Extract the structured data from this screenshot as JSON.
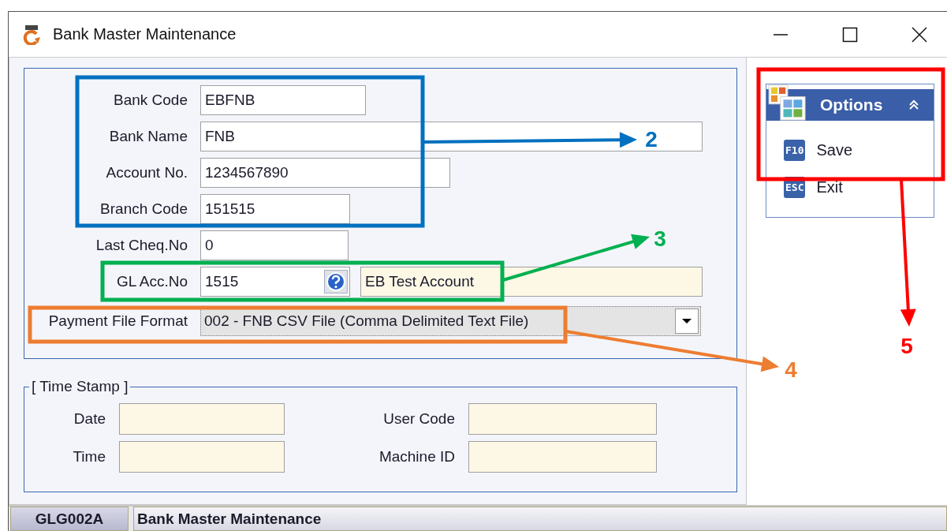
{
  "window": {
    "title": "Bank Master Maintenance"
  },
  "form": {
    "fields": [
      {
        "kind": "text",
        "label": "Bank Code",
        "value": "EBFNB"
      },
      {
        "kind": "text",
        "label": "Bank Name",
        "value": "FNB"
      },
      {
        "kind": "text",
        "label": "Account No.",
        "value": "1234567890"
      },
      {
        "kind": "text",
        "label": "Branch Code",
        "value": "151515"
      },
      {
        "kind": "text",
        "label": "Last Cheq.No",
        "value": "0"
      },
      {
        "kind": "lookup",
        "label": "GL Acc.No",
        "value": "1515",
        "description": "EB Test Account"
      },
      {
        "kind": "combo",
        "label": "Payment File Format",
        "value": "002 - FNB CSV File (Comma Delimited Text File)"
      }
    ]
  },
  "time_stamp": {
    "title": "[ Time Stamp ]",
    "fields": [
      {
        "label": "Date"
      },
      {
        "label": "User Code"
      },
      {
        "label": "Time"
      },
      {
        "label": "Machine ID"
      }
    ]
  },
  "options": {
    "title": "Options",
    "expanded": true,
    "items": [
      {
        "key": "F10",
        "label": "Save"
      },
      {
        "key": "ESC",
        "label": "Exit"
      }
    ]
  },
  "status_bar": {
    "code": "GLG002A",
    "title": "Bank Master Maintenance"
  },
  "annotations": [
    {
      "label": "2",
      "color": "#0070c0"
    },
    {
      "label": "3",
      "color": "#00b050"
    },
    {
      "label": "4",
      "color": "#ed7d31"
    },
    {
      "label": "5",
      "color": "#ff0000"
    }
  ]
}
